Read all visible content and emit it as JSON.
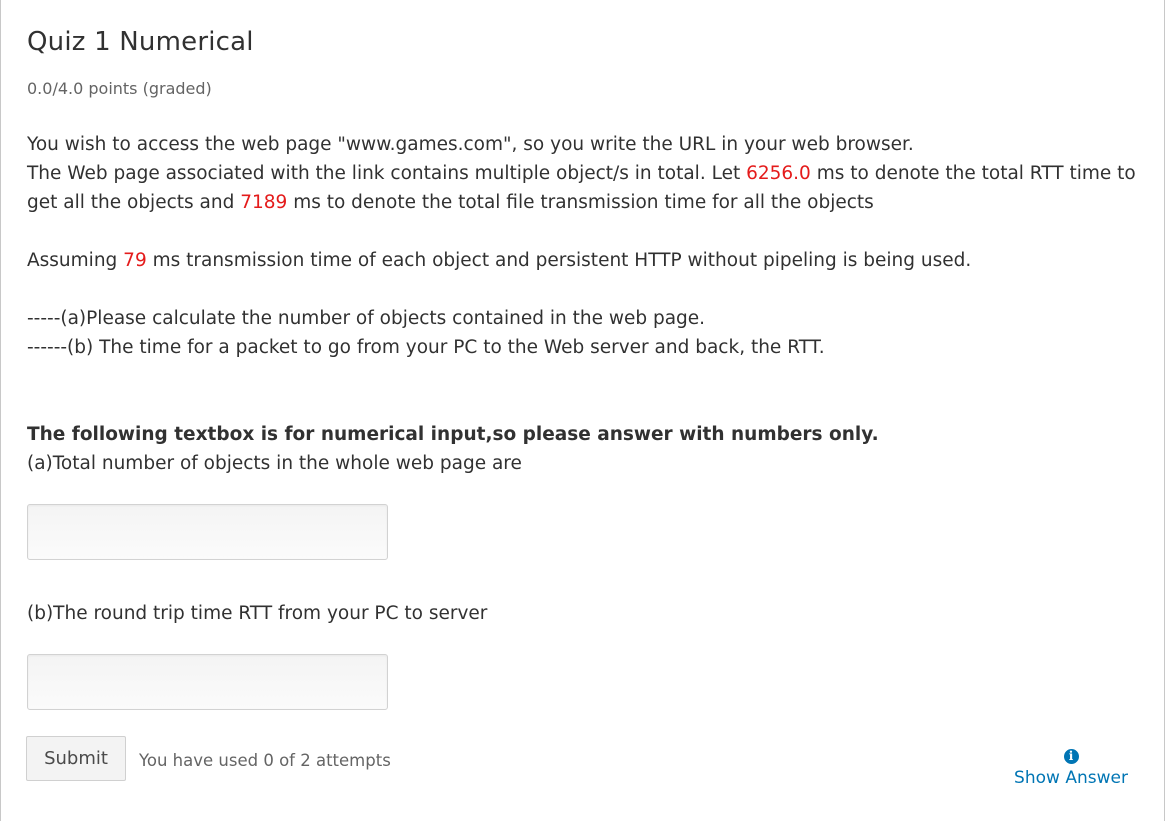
{
  "problem": {
    "title": "Quiz 1 Numerical",
    "points": "0.0/4.0 points (graded)"
  },
  "question": {
    "line1": "You wish to access the web page \"www.games.com\", so you write the URL in your web browser.",
    "line2_part1": "The Web page associated with the link contains multiple object/s in total. Let ",
    "rtt_total": "6256.0",
    "line2_part2": " ms to denote the total RTT time to get all the objects and ",
    "trans_total": "7189",
    "line2_part3": " ms to denote the total file transmission time for all the objects",
    "line3_part1": "Assuming ",
    "trans_each": "79",
    "line3_part2": " ms transmission time of each object and persistent HTTP without pipeling is being used.",
    "part_a": "-----(a)Please calculate the number of objects contained in the web page.",
    "part_b": "------(b) The time for a packet to go from your PC to the Web server and back, the RTT."
  },
  "instructions": {
    "bold_note": "The following textbox is for numerical input,so please answer with numbers only.",
    "label_a": "(a)Total number of objects in the whole web page are",
    "label_b": "(b)The round trip time RTT from your PC to server"
  },
  "inputs": {
    "answer_a": "",
    "answer_b": ""
  },
  "actions": {
    "submit_label": "Submit",
    "attempts_text": "You have used 0 of 2 attempts",
    "show_answer_label": "Show Answer",
    "show_answer_icon": "info-icon"
  },
  "colors": {
    "highlight": "#e41b1b",
    "link": "#0075b4"
  }
}
